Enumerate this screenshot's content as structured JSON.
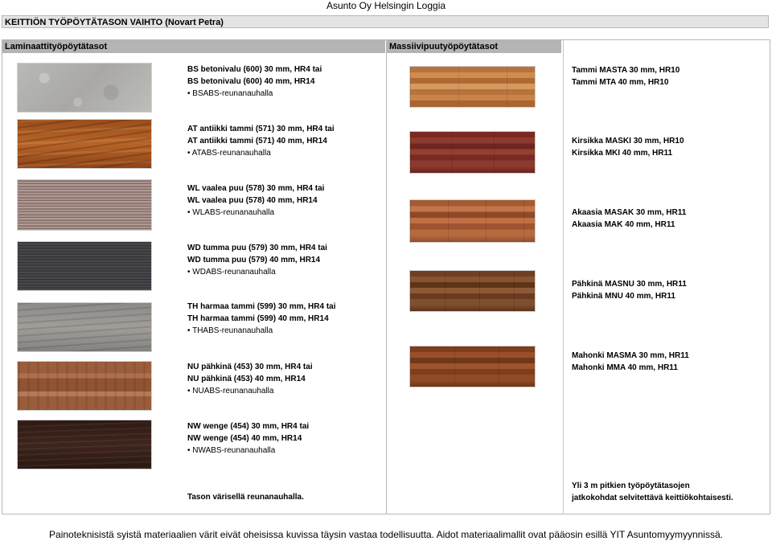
{
  "company": "Asunto Oy Helsingin Loggia",
  "title": "KEITTIÖN TYÖPÖYTÄTASON VAIHTO (Novart Petra)",
  "sections": {
    "laminate": "Laminaattityöpöytätasot",
    "solid": "Massiivipuutyöpöytätasot"
  },
  "laminate": [
    {
      "line1": "BS betonivalu (600) 30 mm, HR4 tai",
      "line2": "BS betonivalu (600) 40 mm, HR14",
      "line3": "• BSABS-reunanauhalla"
    },
    {
      "line1": "AT antiikki tammi (571) 30 mm, HR4 tai",
      "line2": "AT antiikki tammi (571) 40 mm, HR14",
      "line3": "• ATABS-reunanauhalla"
    },
    {
      "line1": "WL vaalea puu (578) 30 mm, HR4 tai",
      "line2": "WL vaalea puu (578) 40 mm, HR14",
      "line3": "• WLABS-reunanauhalla"
    },
    {
      "line1": "WD tumma puu (579) 30 mm, HR4 tai",
      "line2": "WD tumma puu (579) 40 mm, HR14",
      "line3": "• WDABS-reunanauhalla"
    },
    {
      "line1": "TH harmaa tammi (599) 30 mm, HR4 tai",
      "line2": "TH harmaa tammi (599) 40 mm, HR14",
      "line3": "• THABS-reunanauhalla"
    },
    {
      "line1": "NU pähkinä (453) 30 mm, HR4 tai",
      "line2": "NU pähkinä (453) 40 mm, HR14",
      "line3": "• NUABS-reunanauhalla"
    },
    {
      "line1": "NW wenge (454) 30 mm, HR4 tai",
      "line2": "NW wenge (454) 40 mm, HR14",
      "line3": "• NWABS-reunanauhalla"
    }
  ],
  "laminate_note": "Tason värisellä reunanauhalla.",
  "solid": [
    {
      "line1": "Tammi MASTA 30 mm, HR10",
      "line2": "Tammi MTA 40 mm, HR10"
    },
    {
      "line1": "Kirsikka MASKI 30 mm, HR10",
      "line2": "Kirsikka MKI 40 mm, HR11"
    },
    {
      "line1": "Akaasia MASAK 30 mm, HR11",
      "line2": "Akaasia MAK 40 mm, HR11"
    },
    {
      "line1": "Pähkinä MASNU 30 mm, HR11",
      "line2": "Pähkinä MNU 40 mm, HR11"
    },
    {
      "line1": "Mahonki MASMA 30 mm, HR11",
      "line2": "Mahonki MMA 40 mm, HR11"
    }
  ],
  "solid_note": {
    "line1": "Yli 3 m pitkien työpöytätasojen",
    "line2": "jatkokohdat selvitettävä keittiökohtaisesti."
  },
  "footer": "Painoteknisistä syistä materiaalien värit eivät oheisissa kuvissa täysin vastaa todellisuutta. Aidot materiaalimallit ovat pääosin esillä YIT Asuntomyymyynnissä."
}
